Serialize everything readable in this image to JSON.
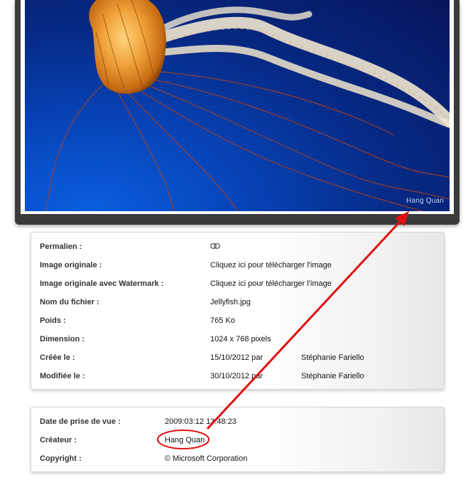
{
  "photo": {
    "watermark": "Hang Quan"
  },
  "details": {
    "permalink": {
      "label": "Permalien :",
      "icon": "link-icon"
    },
    "original": {
      "label": "Image originale :",
      "value": "Cliquez ici pour télécharger l'image"
    },
    "watermarked": {
      "label": "Image originale avec Watermark :",
      "value": "Cliquez ici pour télécharger l'image"
    },
    "filename": {
      "label": "Nom du fichier :",
      "value": "Jellyfish.jpg"
    },
    "weight": {
      "label": "Poids :",
      "value": "765 Ko"
    },
    "dimension": {
      "label": "Dimension :",
      "value": "1024 x 768 pixels"
    },
    "created": {
      "label": "Créée le :",
      "value": "15/10/2012 par",
      "author": "Stéphanie Fariello"
    },
    "modified": {
      "label": "Modifiée le :",
      "value": "30/10/2012 par",
      "author": "Stéphanie Fariello"
    }
  },
  "exif": {
    "date_taken": {
      "label": "Date de prise de vue :",
      "value": "2009:03:12 13:48:23"
    },
    "creator": {
      "label": "Créateur :",
      "value": "Hang Quan"
    },
    "copyright": {
      "label": "Copyright :",
      "value": "© Microsoft Corporation"
    }
  },
  "colors": {
    "annotation": "#e01010",
    "frame": "#3a3a3a"
  }
}
